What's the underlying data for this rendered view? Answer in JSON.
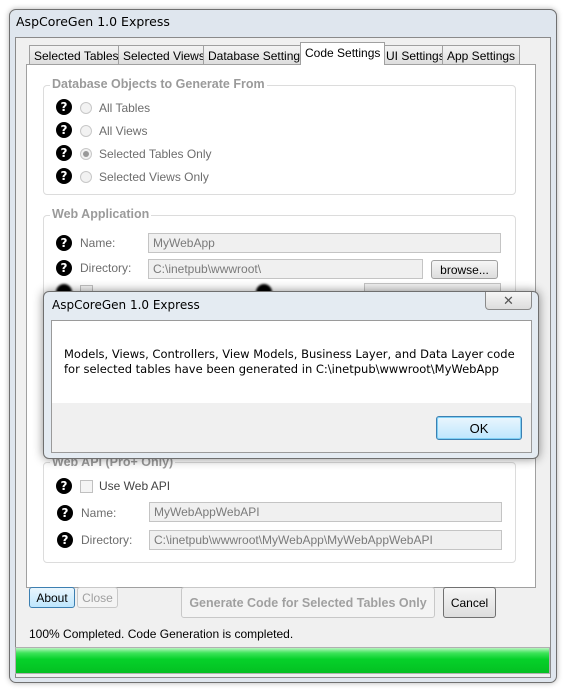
{
  "window": {
    "title": "AspCoreGen 1.0 Express"
  },
  "tabs": [
    {
      "label": "Selected Tables"
    },
    {
      "label": "Selected Views"
    },
    {
      "label": "Database Settings"
    },
    {
      "label": "Code Settings",
      "active": true
    },
    {
      "label": "UI Settings"
    },
    {
      "label": "App Settings"
    }
  ],
  "db_objects": {
    "title": "Database Objects to Generate From",
    "options": [
      {
        "label": "All Tables",
        "selected": false
      },
      {
        "label": "All Views",
        "selected": false
      },
      {
        "label": "Selected Tables Only",
        "selected": true
      },
      {
        "label": "Selected Views Only",
        "selected": false
      }
    ]
  },
  "web_app": {
    "title": "Web Application",
    "name_label": "Name:",
    "name_value": "MyWebApp",
    "dir_label": "Directory:",
    "dir_value": "C:\\inetpub\\wwwroot\\",
    "browse_label": "browse..."
  },
  "web_api": {
    "title": "Web API (Pro+ Only)",
    "use_label": "Use Web API",
    "use_checked": false,
    "name_label": "Name:",
    "name_value": "MyWebAppWebAPI",
    "dir_label": "Directory:",
    "dir_value": "C:\\inetpub\\wwwroot\\MyWebApp\\MyWebAppWebAPI"
  },
  "buttons": {
    "about": "About",
    "close": "Close",
    "generate": "Generate Code for Selected Tables Only",
    "cancel": "Cancel"
  },
  "status": {
    "text": "100% Completed.  Code Generation is completed.",
    "progress_percent": 100,
    "progress_color": "#06d12a"
  },
  "dialog": {
    "title": "AspCoreGen 1.0 Express",
    "message": "Models, Views, Controllers, View Models, Business Layer, and Data Layer code for selected tables have been generated in C:\\inetpub\\wwwroot\\MyWebApp",
    "ok": "OK",
    "close_icon": "close-icon"
  },
  "icons": {
    "help": "?"
  }
}
